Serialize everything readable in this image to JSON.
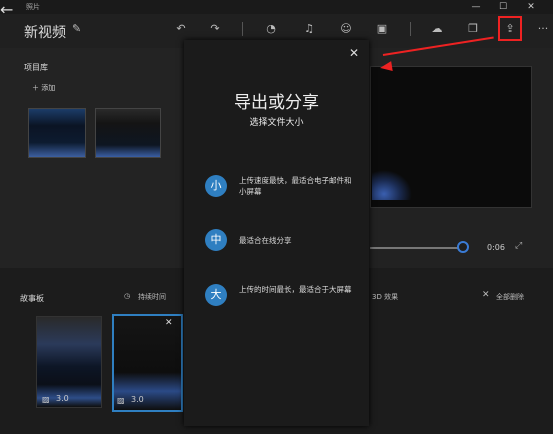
{
  "titlebar": {
    "back_glyph": "←",
    "app_title": "照片",
    "minimize": "—",
    "maximize": "☐",
    "close": "✕"
  },
  "toolbar": {
    "project_title": "新视频",
    "undo_icon": "undo-icon",
    "redo_icon": "redo-icon",
    "more": "···"
  },
  "library": {
    "title": "项目库",
    "add_label": "＋ 添加"
  },
  "player": {
    "time": "0:06"
  },
  "storyboard": {
    "title": "故事板",
    "duration_label": "持续时间",
    "effects_label": "3D 效果",
    "delete_all_label": "全部删除",
    "clips": [
      {
        "duration": "3.0"
      },
      {
        "duration": "3.0"
      }
    ]
  },
  "modal": {
    "heading": "导出或分享",
    "subheading": "选择文件大小",
    "options": [
      {
        "size": "小",
        "desc": "上传速度最快，最适合电子邮件和小屏幕"
      },
      {
        "size": "中",
        "desc": "最适合在线分享"
      },
      {
        "size": "大",
        "desc": "上传的时间最长，最适合于大屏幕"
      }
    ]
  },
  "colors": {
    "accent": "#2f7fc1",
    "highlight": "#e22222"
  }
}
